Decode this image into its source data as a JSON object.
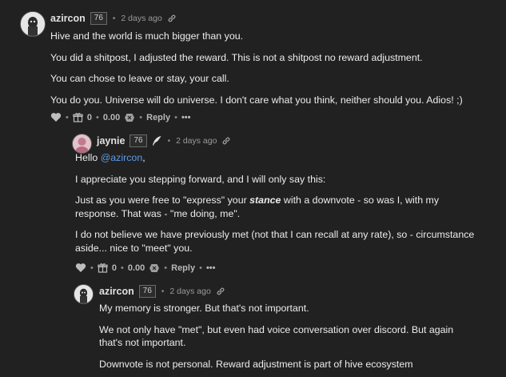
{
  "comments": [
    {
      "author": "azircon",
      "reputation": "76",
      "date": "2 days ago",
      "paragraphs": [
        "Hive and the world is much bigger than you.",
        "You did a shitpost, I adjusted the reward. This is not a shitpost no reward adjustment.",
        "You can chose to leave or stay, your call.",
        "You do you. Universe will do universe. I don't care what you think, neither should you. Adios! ;)"
      ],
      "actions": {
        "gift_count": "0",
        "payout": "0.00",
        "reply_label": "Reply",
        "more_label": "•••"
      }
    },
    {
      "author": "jaynie",
      "reputation": "76",
      "date": "2 days ago",
      "greeting_prefix": "Hello ",
      "mention": "@azircon",
      "greeting_suffix": ",",
      "paragraphs": [
        "I appreciate you stepping forward, and I will only say this:"
      ],
      "p3_before": "Just as you were free to \"express\" your ",
      "p3_emphasis": "stance",
      "p3_after": " with a downvote - so was I, with my response. That was - \"me doing, me\".",
      "p4": "I do not believe we have previously met (not that I can recall at any rate), so - circumstance aside... nice to \"meet\" you.",
      "actions": {
        "gift_count": "0",
        "payout": "0.00",
        "reply_label": "Reply",
        "more_label": "•••"
      }
    },
    {
      "author": "azircon",
      "reputation": "76",
      "date": "2 days ago",
      "paragraphs": [
        "My memory is stronger. But that's not important.",
        "We not only have \"met\", but even had voice conversation over discord. But again that's not important.",
        "Downvote is not personal. Reward adjustment is part of hive ecosystem"
      ]
    }
  ],
  "colors": {
    "background": "#212121",
    "text": "#ececec",
    "mention": "#5b9ce8",
    "muted": "#9a9a9a"
  },
  "icons": [
    "heart-icon",
    "gift-icon",
    "hive-icon",
    "link-icon",
    "quill-icon"
  ]
}
